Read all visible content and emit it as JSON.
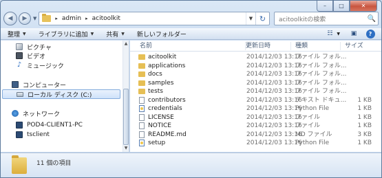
{
  "window": {
    "caption": {
      "min": "–",
      "max": "□",
      "close": "✕"
    }
  },
  "nav": {
    "back": "◀",
    "forward": "▶",
    "recent": "▼"
  },
  "address": {
    "crumbs": [
      "admin",
      "acitoolkit"
    ],
    "separator": "▸",
    "dropdown": "▼",
    "refresh": "↻"
  },
  "search": {
    "placeholder": "acitoolkitの検索",
    "icon": "🔍"
  },
  "toolbar": {
    "organize": "整理",
    "add_to_library": "ライブラリに追加",
    "share": "共有",
    "new_folder": "新しいフォルダー",
    "arrow": "▼",
    "view_icon": "☷",
    "view_arrow": "▼",
    "preview_icon": "▣",
    "help_icon": "?"
  },
  "navpane": {
    "items": [
      {
        "label": "ピクチャ"
      },
      {
        "label": "ビデオ"
      },
      {
        "label": "ミュージック",
        "glyph": "♪"
      },
      {
        "label": "コンピューター"
      },
      {
        "label": "ローカル ディスク (C:)"
      },
      {
        "label": "ネットワーク"
      },
      {
        "label": "POD4-CLIENT1-PC"
      },
      {
        "label": "tsclient"
      }
    ],
    "scroll_up": "▲",
    "scroll_down": "▼"
  },
  "columns": {
    "name": "名前",
    "date": "更新日時",
    "type": "種類",
    "size": "サイズ"
  },
  "files": [
    {
      "name": "acitoolkit",
      "date": "2014/12/03 13:16",
      "type": "ファイル フォル...",
      "size": "",
      "kind": "folder"
    },
    {
      "name": "applications",
      "date": "2014/12/03 13:16",
      "type": "ファイル フォル...",
      "size": "",
      "kind": "folder"
    },
    {
      "name": "docs",
      "date": "2014/12/03 13:16",
      "type": "ファイル フォル...",
      "size": "",
      "kind": "folder"
    },
    {
      "name": "samples",
      "date": "2014/12/03 13:16",
      "type": "ファイル フォル...",
      "size": "",
      "kind": "folder"
    },
    {
      "name": "tests",
      "date": "2014/12/03 13:16",
      "type": "ファイル フォル...",
      "size": "",
      "kind": "folder"
    },
    {
      "name": "contributors",
      "date": "2014/12/03 13:16",
      "type": "テキスト ドキュ...",
      "size": "1 KB",
      "kind": "file"
    },
    {
      "name": "credentials",
      "date": "2014/12/03 13:16",
      "type": "Python File",
      "size": "1 KB",
      "kind": "py"
    },
    {
      "name": "LICENSE",
      "date": "2014/12/03 13:16",
      "type": "ファイル",
      "size": "1 KB",
      "kind": "file"
    },
    {
      "name": "NOTICE",
      "date": "2014/12/03 13:16",
      "type": "ファイル",
      "size": "1 KB",
      "kind": "file"
    },
    {
      "name": "README.md",
      "date": "2014/12/03 13:16",
      "type": "MD ファイル",
      "size": "3 KB",
      "kind": "file"
    },
    {
      "name": "setup",
      "date": "2014/12/03 13:16",
      "type": "Python File",
      "size": "1 KB",
      "kind": "py"
    }
  ],
  "status": {
    "count": "11 個の項目"
  }
}
